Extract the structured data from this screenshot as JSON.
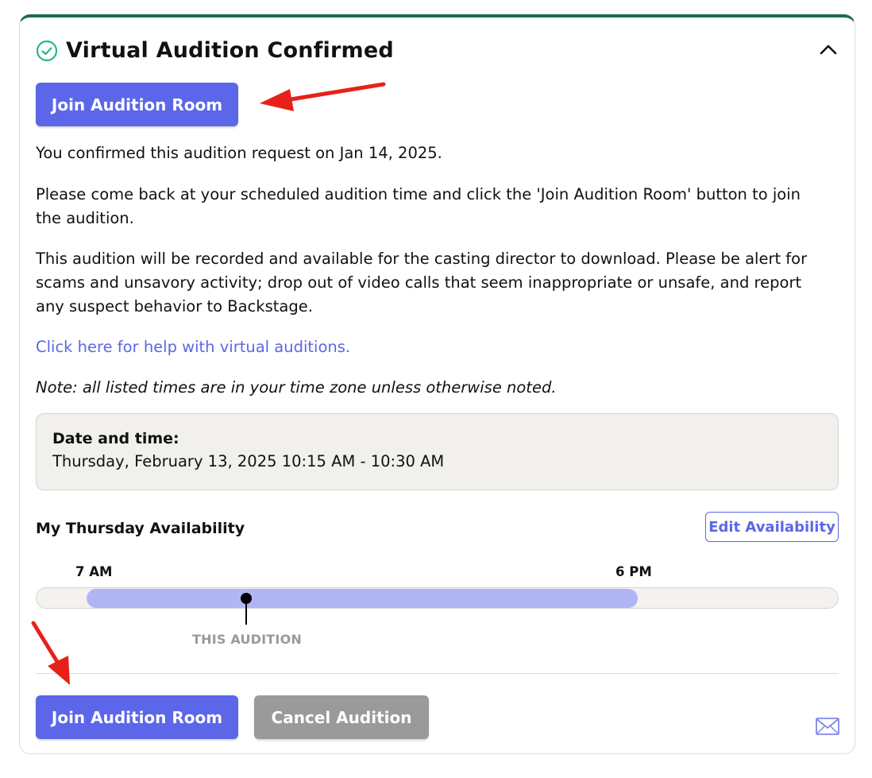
{
  "card": {
    "title": "Virtual Audition Confirmed",
    "status_icon": "check-circle-icon",
    "collapse_icon": "chevron-up-icon",
    "accent_color": "#1b6b5a"
  },
  "buttons": {
    "join_top": "Join Audition Room",
    "join_bottom": "Join Audition Room",
    "cancel": "Cancel Audition",
    "edit_availability": "Edit Availability",
    "primary_color": "#5b67e8"
  },
  "body": {
    "confirmed_text": "You confirmed this audition request on Jan 14, 2025.",
    "instructions": "Please come back at your scheduled audition time and click the 'Join Audition Room' button to join the audition.",
    "recording_notice": "This audition will be recorded and available for the casting director to download. Please be alert for scams and unsavory activity; drop out of video calls that seem inappropriate or unsafe, and report any suspect behavior to Backstage.",
    "help_link": "Click here for help with virtual auditions.",
    "note": "Note: all listed times are in your time zone unless otherwise noted."
  },
  "schedule": {
    "label": "Date and time:",
    "value": "Thursday, February 13, 2025 10:15 AM - 10:30 AM"
  },
  "availability": {
    "title": "My Thursday Availability",
    "start_label": "7 AM",
    "end_label": "6 PM",
    "marker_label": "THIS AUDITION",
    "range_color": "#b1b5f3"
  },
  "footer": {
    "mail_icon": "envelope-icon"
  }
}
